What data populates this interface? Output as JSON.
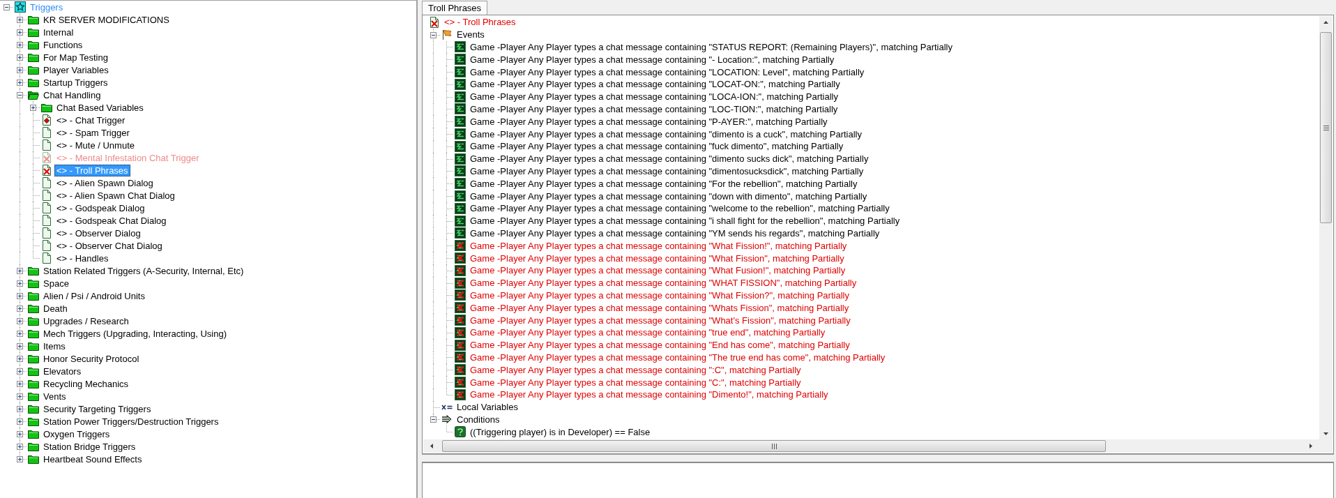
{
  "tree": {
    "items": [
      {
        "label": "Triggers",
        "kind": "root",
        "expanded": true,
        "selected": false,
        "children": [
          {
            "label": "KR SERVER MODIFICATIONS",
            "kind": "folder",
            "expanded": false,
            "selected": false
          },
          {
            "label": "Internal",
            "kind": "folder",
            "expanded": false,
            "selected": false
          },
          {
            "label": "Functions",
            "kind": "folder",
            "expanded": false,
            "selected": false
          },
          {
            "label": "For Map Testing",
            "kind": "folder",
            "expanded": false,
            "selected": false
          },
          {
            "label": "Player Variables",
            "kind": "folder",
            "expanded": false,
            "selected": false
          },
          {
            "label": "Startup Triggers",
            "kind": "folder",
            "expanded": false,
            "selected": false
          },
          {
            "label": "Chat Handling",
            "kind": "folder",
            "expanded": true,
            "selected": false,
            "children": [
              {
                "label": "Chat Based Variables",
                "kind": "folder",
                "expanded": false,
                "selected": false
              },
              {
                "label": "<> - Chat Trigger",
                "kind": "trigger",
                "marked": true,
                "disabled": false,
                "dimmed": false,
                "selected": false
              },
              {
                "label": "<> - Spam Trigger",
                "kind": "trigger",
                "marked": false,
                "disabled": false,
                "dimmed": false,
                "selected": false
              },
              {
                "label": "<> - Mute / Unmute",
                "kind": "trigger",
                "marked": false,
                "disabled": false,
                "dimmed": false,
                "selected": false
              },
              {
                "label": "<> - Mental Infestation Chat Trigger",
                "kind": "trigger",
                "marked": false,
                "disabled": true,
                "dimmed": true,
                "selected": false
              },
              {
                "label": "<> - Troll Phrases",
                "kind": "trigger",
                "marked": false,
                "disabled": true,
                "dimmed": false,
                "selected": true
              },
              {
                "label": "<> - Alien Spawn Dialog",
                "kind": "trigger",
                "marked": false,
                "disabled": false,
                "dimmed": false,
                "selected": false
              },
              {
                "label": "<> - Alien Spawn Chat Dialog",
                "kind": "trigger",
                "marked": false,
                "disabled": false,
                "dimmed": false,
                "selected": false
              },
              {
                "label": "<> - Godspeak Dialog",
                "kind": "trigger",
                "marked": false,
                "disabled": false,
                "dimmed": false,
                "selected": false
              },
              {
                "label": "<> - Godspeak Chat Dialog",
                "kind": "trigger",
                "marked": false,
                "disabled": false,
                "dimmed": false,
                "selected": false
              },
              {
                "label": "<> - Observer Dialog",
                "kind": "trigger",
                "marked": false,
                "disabled": false,
                "dimmed": false,
                "selected": false
              },
              {
                "label": "<> - Observer Chat Dialog",
                "kind": "trigger",
                "marked": false,
                "disabled": false,
                "dimmed": false,
                "selected": false
              },
              {
                "label": "<> - Handles",
                "kind": "trigger",
                "marked": false,
                "disabled": false,
                "dimmed": false,
                "selected": false
              }
            ]
          },
          {
            "label": "Station Related Triggers (A-Security, Internal, Etc)",
            "kind": "folder",
            "expanded": false,
            "selected": false
          },
          {
            "label": "Space",
            "kind": "folder",
            "expanded": false,
            "selected": false
          },
          {
            "label": "Alien / Psi / Android Units",
            "kind": "folder",
            "expanded": false,
            "selected": false
          },
          {
            "label": "Death",
            "kind": "folder",
            "expanded": false,
            "selected": false
          },
          {
            "label": "Upgrades / Research",
            "kind": "folder",
            "expanded": false,
            "selected": false
          },
          {
            "label": "Mech Triggers (Upgrading, Interacting, Using)",
            "kind": "folder",
            "expanded": false,
            "selected": false
          },
          {
            "label": "Items",
            "kind": "folder",
            "expanded": false,
            "selected": false
          },
          {
            "label": "Honor Security Protocol",
            "kind": "folder",
            "expanded": false,
            "selected": false
          },
          {
            "label": "Elevators",
            "kind": "folder",
            "expanded": false,
            "selected": false
          },
          {
            "label": "Recycling Mechanics",
            "kind": "folder",
            "expanded": false,
            "selected": false
          },
          {
            "label": "Vents",
            "kind": "folder",
            "expanded": false,
            "selected": false
          },
          {
            "label": "Security Targeting Triggers",
            "kind": "folder",
            "expanded": false,
            "selected": false
          },
          {
            "label": "Station Power Triggers/Destruction Triggers",
            "kind": "folder",
            "expanded": false,
            "selected": false
          },
          {
            "label": "Oxygen Triggers",
            "kind": "folder",
            "expanded": false,
            "selected": false
          },
          {
            "label": "Station Bridge Triggers",
            "kind": "folder",
            "expanded": false,
            "selected": false
          },
          {
            "label": "Heartbeat Sound Effects",
            "kind": "folder",
            "expanded": false,
            "selected": false
          }
        ]
      }
    ]
  },
  "editor": {
    "tabs": [
      {
        "label": "Troll Phrases",
        "selected": true
      }
    ],
    "title": {
      "label": "<> - Troll Phrases",
      "disabled": true,
      "selected": false
    },
    "sections": [
      {
        "kind": "events",
        "label": "Events",
        "expanded": true,
        "selected": false,
        "items": [
          {
            "text": "Game -Player Any Player types a chat message containing \"STATUS REPORT: (Remaining Players)\", matching Partially",
            "disabled": false,
            "selected": false
          },
          {
            "text": "Game -Player Any Player types a chat message containing \"- Location:\", matching Partially",
            "disabled": false,
            "selected": false
          },
          {
            "text": "Game -Player Any Player types a chat message containing \"LOCATION: Level\", matching Partially",
            "disabled": false,
            "selected": false
          },
          {
            "text": "Game -Player Any Player types a chat message containing \"LOCAT-ON:\", matching Partially",
            "disabled": false,
            "selected": false
          },
          {
            "text": "Game -Player Any Player types a chat message containing \"LOCA-ION:\", matching Partially",
            "disabled": false,
            "selected": false
          },
          {
            "text": "Game -Player Any Player types a chat message containing \"LOC-TION:\", matching Partially",
            "disabled": false,
            "selected": false
          },
          {
            "text": "Game -Player Any Player types a chat message containing \"P-AYER:\", matching Partially",
            "disabled": false,
            "selected": false
          },
          {
            "text": "Game -Player Any Player types a chat message containing \"dimento is a cuck\", matching Partially",
            "disabled": false,
            "selected": false
          },
          {
            "text": "Game -Player Any Player types a chat message containing \"fuck dimento\", matching Partially",
            "disabled": false,
            "selected": false
          },
          {
            "text": "Game -Player Any Player types a chat message containing \"dimento sucks dick\", matching Partially",
            "disabled": false,
            "selected": false
          },
          {
            "text": "Game -Player Any Player types a chat message containing \"dimentosucksdick\", matching Partially",
            "disabled": false,
            "selected": false
          },
          {
            "text": "Game -Player Any Player types a chat message containing \"For the rebellion\", matching Partially",
            "disabled": false,
            "selected": false
          },
          {
            "text": "Game -Player Any Player types a chat message containing \"down with dimento\", matching Partially",
            "disabled": false,
            "selected": false
          },
          {
            "text": "Game -Player Any Player types a chat message containing \"welcome to the rebellion\", matching Partially",
            "disabled": false,
            "selected": false
          },
          {
            "text": "Game -Player Any Player types a chat message containing \"i shall fight for the rebellion\", matching Partially",
            "disabled": false,
            "selected": false
          },
          {
            "text": "Game -Player Any Player types a chat message containing \"YM sends his regards\", matching Partially",
            "disabled": false,
            "selected": false
          },
          {
            "text": "Game -Player Any Player types a chat message containing \"What Fission!\", matching Partially",
            "disabled": true,
            "selected": false
          },
          {
            "text": "Game -Player Any Player types a chat message containing \"What Fission\", matching Partially",
            "disabled": true,
            "selected": false
          },
          {
            "text": "Game -Player Any Player types a chat message containing \"What Fusion!\", matching Partially",
            "disabled": true,
            "selected": false
          },
          {
            "text": "Game -Player Any Player types a chat message containing \"WHAT FISSION\", matching Partially",
            "disabled": true,
            "selected": false
          },
          {
            "text": "Game -Player Any Player types a chat message containing \"What Fission?\", matching Partially",
            "disabled": true,
            "selected": false
          },
          {
            "text": "Game -Player Any Player types a chat message containing \"Whats Fission\", matching Partially",
            "disabled": true,
            "selected": false
          },
          {
            "text": "Game -Player Any Player types a chat message containing \"What's Fission\", matching Partially",
            "disabled": true,
            "selected": false
          },
          {
            "text": "Game -Player Any Player types a chat message containing \"true end\", matching Partially",
            "disabled": true,
            "selected": false
          },
          {
            "text": "Game -Player Any Player types a chat message containing \"End has come\", matching Partially",
            "disabled": true,
            "selected": false
          },
          {
            "text": "Game -Player Any Player types a chat message containing \"The true end has come\", matching Partially",
            "disabled": true,
            "selected": false
          },
          {
            "text": "Game -Player Any Player types a chat message containing \":C\", matching Partially",
            "disabled": true,
            "selected": false
          },
          {
            "text": "Game -Player Any Player types a chat message containing \"C:\", matching Partially",
            "disabled": true,
            "selected": false
          },
          {
            "text": "Game -Player Any Player types a chat message containing \"Dimento!\", matching Partially",
            "disabled": true,
            "selected": false
          }
        ]
      },
      {
        "kind": "variables",
        "label": "Local Variables",
        "selected": false
      },
      {
        "kind": "conditions",
        "label": "Conditions",
        "expanded": true,
        "selected": false,
        "items": [
          {
            "text": "((Triggering player) is in Developer) == False",
            "disabled": false,
            "selected": false
          }
        ]
      }
    ]
  }
}
